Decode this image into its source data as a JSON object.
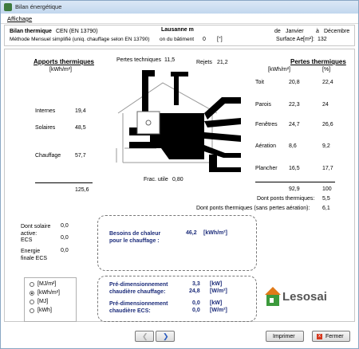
{
  "window": {
    "title": "Bilan énergétique"
  },
  "menu": {
    "affichage": "Affichage"
  },
  "header": {
    "label": "Bilan thermique",
    "norm": "CEN (EN 13790)",
    "method": "Méthode Mensuel simplifié (uniq. chauffage selon EN 13790)",
    "location": "Lausanne m",
    "orientation_label": "on du bâtiment",
    "orientation_value": "0",
    "orientation_unit": "[°]",
    "period_from_label": "de",
    "period_from": "Janvier",
    "period_to_label": "à",
    "period_to": "Décembre",
    "area_label": "Surface Ae",
    "area_unit": "[m²]:",
    "area_value": "132"
  },
  "gains": {
    "title": "Apports thermiques",
    "unit": "[kWh/m²]",
    "items": [
      {
        "label": "Internes",
        "value": "19,4"
      },
      {
        "label": "Solaires",
        "value": "48,5"
      },
      {
        "label": "Chauffage",
        "value": "57,7"
      }
    ],
    "total": "125,6"
  },
  "diagram": {
    "technical_losses_label": "Pertes techniques",
    "technical_losses_value": "11,5",
    "rejects_label": "Rejets",
    "rejects_value": "21,2",
    "util_factor_label": "Frac. utile",
    "util_factor_value": "0,80"
  },
  "losses": {
    "title": "Pertes thermiques",
    "unit_col1": "[kWh/m²]",
    "unit_col2": "[%]",
    "items": [
      {
        "label": "Toit",
        "value": "20,8",
        "pct": "22,4"
      },
      {
        "label": "Parois",
        "value": "22,3",
        "pct": "24"
      },
      {
        "label": "Fenêtres",
        "value": "24,7",
        "pct": "26,6"
      },
      {
        "label": "Aération",
        "value": "8,6",
        "pct": "9,2"
      },
      {
        "label": "Plancher",
        "value": "16,5",
        "pct": "17,7"
      }
    ],
    "total": "92,9",
    "total_pct": "100",
    "thermal_bridges_label": "Dont ponts thermiques:",
    "thermal_bridges_value": "5,5",
    "thermal_bridges_noair_label": "Dont ponts thermiques (sans pertes aération):",
    "thermal_bridges_noair_value": "6,1"
  },
  "side": {
    "solar_active_label": "Dont solaire active:",
    "solar_active_value": "0,0",
    "ecs_label": "ECS",
    "ecs_value": "0,0",
    "final_energy_label": "Energie finale ECS",
    "final_energy_value": "0,0"
  },
  "needs": {
    "label": "Besoins de chaleur pour le chauffage :",
    "value": "46,2",
    "unit": "[kWh/m²]"
  },
  "sizing": {
    "heating_label": "Pré-dimensionnement chaudière chauffage:",
    "heating_kw": "3,3",
    "heating_kw_unit": "[kW]",
    "heating_wm2": "24,8",
    "heating_wm2_unit": "[W/m²]",
    "ecs_label": "Pré-dimensionnement chaudière ECS:",
    "ecs_kw": "0,0",
    "ecs_kw_unit": "[kW]",
    "ecs_wm2": "0,0",
    "ecs_wm2_unit": "[W/m²]"
  },
  "units": {
    "options": [
      "[MJ/m²]",
      "[kWh/m²]",
      "[MJ]",
      "[kWh]"
    ],
    "selected": "[kWh/m²]"
  },
  "logo": {
    "text": "Lesosai"
  },
  "buttons": {
    "print": "Imprimer",
    "close": "Fermer"
  },
  "colors": {
    "navy": "#1c2c7a",
    "logo_orange": "#e07a18",
    "logo_green": "#3c9a3c"
  }
}
